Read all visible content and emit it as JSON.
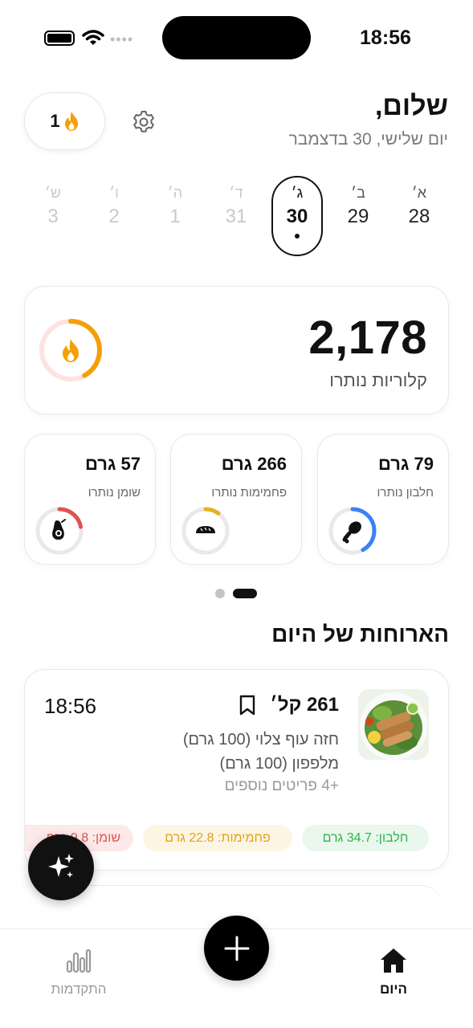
{
  "status_bar": {
    "time": "18:56"
  },
  "header": {
    "streak_count": "1",
    "greeting": "שלום,",
    "date": "יום שלישי, 30 בדצמבר"
  },
  "week": [
    {
      "letter": "א׳",
      "number": "28"
    },
    {
      "letter": "ב׳",
      "number": "29"
    },
    {
      "letter": "ג׳",
      "number": "30"
    },
    {
      "letter": "ד׳",
      "number": "31"
    },
    {
      "letter": "ה׳",
      "number": "1"
    },
    {
      "letter": "ו׳",
      "number": "2"
    },
    {
      "letter": "ש׳",
      "number": "3"
    }
  ],
  "calories": {
    "value": "2,178",
    "label": "קלוריות נותרו",
    "ring_fraction": 0.42
  },
  "macros": [
    {
      "value": "79 גרם",
      "label": "חלבון נותרו",
      "color": "#3b82f6",
      "fraction": 0.42
    },
    {
      "value": "266 גרם",
      "label": "פחמימות נותרו",
      "color": "#e5b21a",
      "fraction": 0.1
    },
    {
      "value": "57 גרם",
      "label": "שומן נותרו",
      "color": "#e05252",
      "fraction": 0.22
    }
  ],
  "section_title": "הארוחות של היום",
  "meal": {
    "calories": "261 קל׳",
    "time": "18:56",
    "items": [
      "חזה עוף צלוי (100 גרם)",
      "מלפפון (100 גרם)"
    ],
    "more": "+4 פריטים נוספים",
    "protein": "חלבון: 34.7 גרם",
    "carbs": "פחמימות: 22.8 גרם",
    "fat": "שומן: 9.8 גרם"
  },
  "nav": {
    "progress": "התקדמות",
    "today": "היום"
  },
  "colors": {
    "accent": "#111111",
    "flame": "#f2a007"
  }
}
